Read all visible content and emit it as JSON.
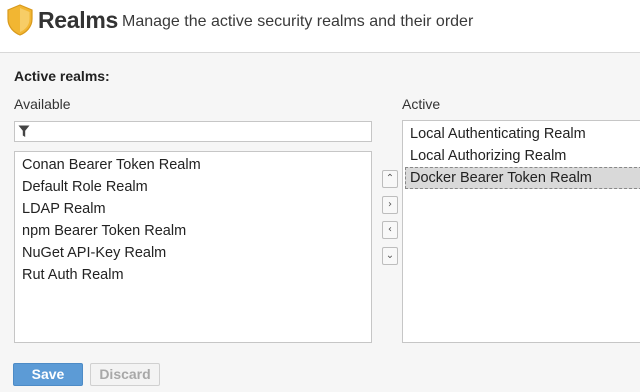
{
  "header": {
    "title": "Realms",
    "subtitle": "Manage the active security realms and their order",
    "icon": "shield-icon",
    "icon_color": "#f2b632"
  },
  "section": {
    "label": "Active realms:"
  },
  "available": {
    "label": "Available",
    "filter_placeholder": "",
    "items": [
      "Conan Bearer Token Realm",
      "Default Role Realm",
      "LDAP Realm",
      "npm Bearer Token Realm",
      "NuGet API-Key Realm",
      "Rut Auth Realm"
    ]
  },
  "active": {
    "label": "Active",
    "items": [
      "Local Authenticating Realm",
      "Local Authorizing Realm",
      "Docker Bearer Token Realm"
    ],
    "selected_item": "Docker Bearer Token Realm"
  },
  "controls": {
    "move_up": "^",
    "move_right": ">",
    "move_left": "<",
    "move_down": "v"
  },
  "buttons": {
    "save": "Save",
    "discard": "Discard"
  },
  "colors": {
    "save_button": "#5c9bd6",
    "panel_background": "#f6f6f6",
    "selected_row": "#d9d9d9"
  }
}
